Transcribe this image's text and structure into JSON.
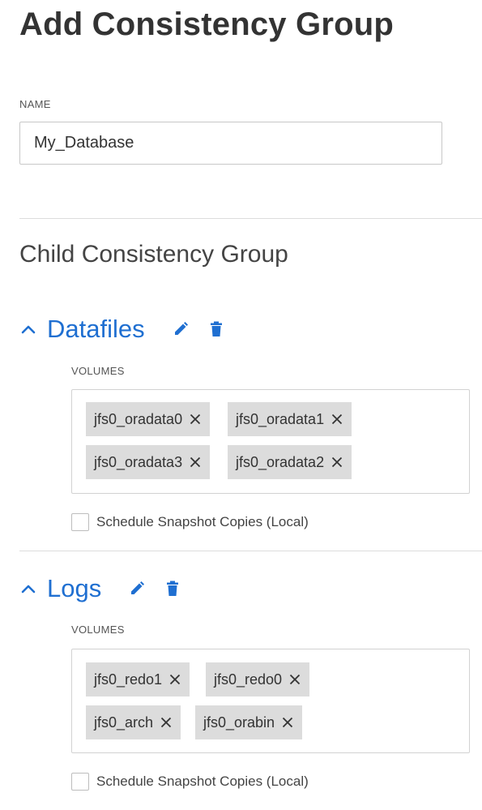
{
  "page": {
    "title": "Add Consistency Group"
  },
  "name_field": {
    "label": "NAME",
    "value": "My_Database"
  },
  "child_section": {
    "title": "Child Consistency Group"
  },
  "colors": {
    "accent": "#1f6fd1",
    "chip_bg": "#dcdcdc"
  },
  "icons": {
    "collapse": "chevron-up-icon",
    "edit": "pencil-icon",
    "delete": "trash-icon",
    "remove": "close-icon"
  },
  "groups": [
    {
      "name": "Datafiles",
      "volumes_label": "VOLUMES",
      "volumes": [
        "jfs0_oradata0",
        "jfs0_oradata1",
        "jfs0_oradata3",
        "jfs0_oradata2"
      ],
      "schedule_label": "Schedule Snapshot Copies (Local)",
      "schedule_checked": false
    },
    {
      "name": "Logs",
      "volumes_label": "VOLUMES",
      "volumes": [
        "jfs0_redo1",
        "jfs0_redo0",
        "jfs0_arch",
        "jfs0_orabin"
      ],
      "schedule_label": "Schedule Snapshot Copies (Local)",
      "schedule_checked": false
    }
  ]
}
